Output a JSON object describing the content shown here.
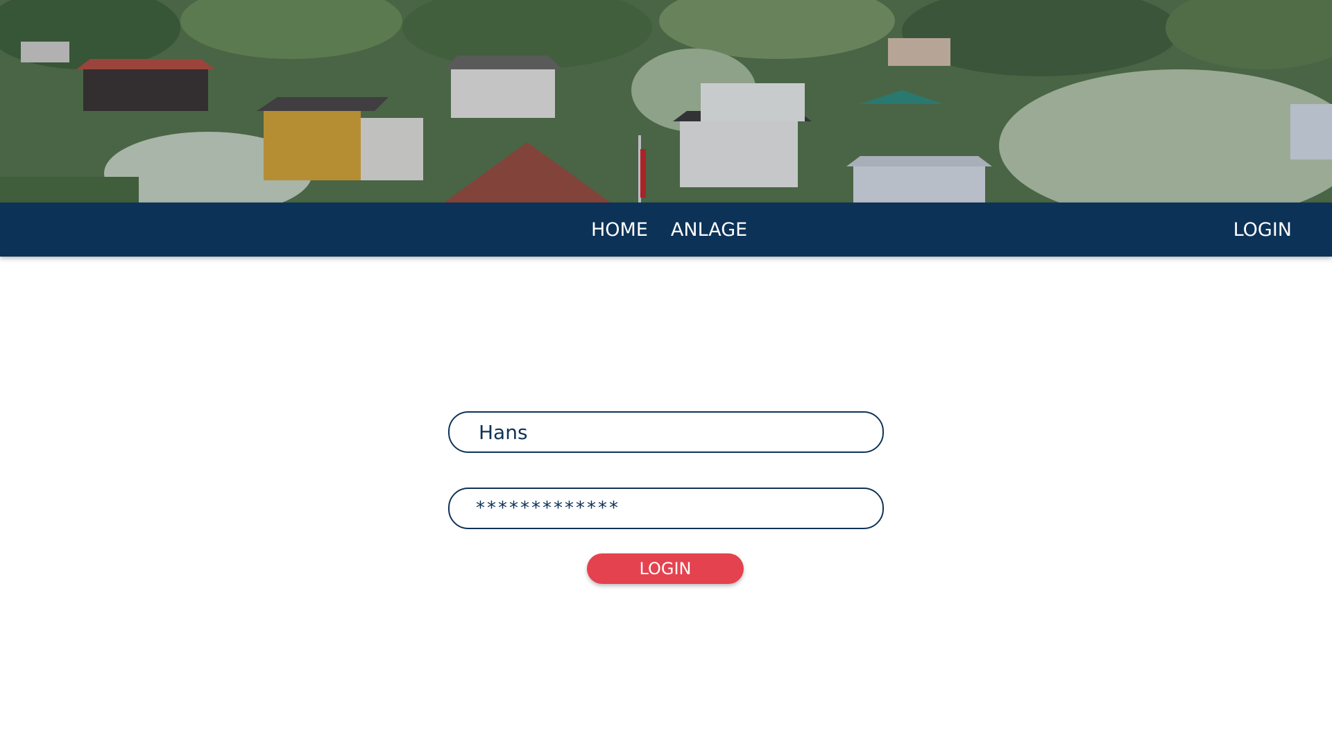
{
  "hero": {
    "image": "allotment-gardens-photo"
  },
  "nav": {
    "items": [
      {
        "label": "HOME"
      },
      {
        "label": "ANLAGE"
      }
    ],
    "login_label": "LOGIN"
  },
  "login_form": {
    "username_value": "Hans",
    "password_value": "*************",
    "submit_label": "LOGIN"
  },
  "colors": {
    "navbar": "#0d3257",
    "accent": "#e5424f",
    "background": "#ffffff"
  }
}
